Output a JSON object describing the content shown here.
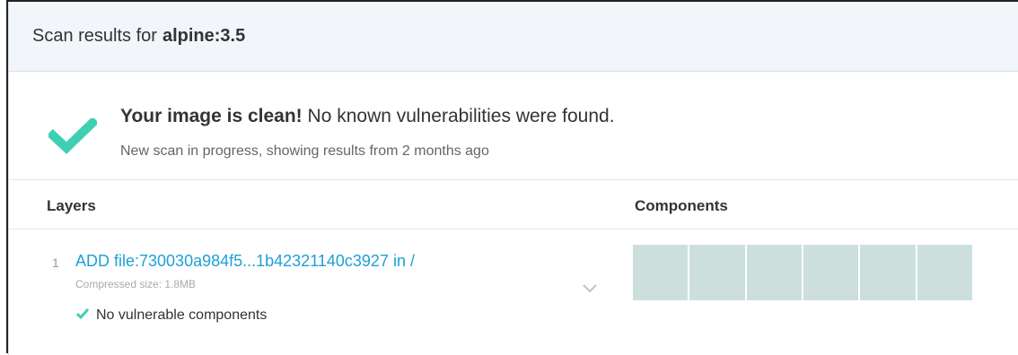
{
  "header": {
    "prefix": "Scan results for",
    "image_name": "alpine:3.5"
  },
  "status": {
    "title_bold": "Your image is clean!",
    "title_rest": "No known vulnerabilities were found.",
    "subtitle": "New scan in progress, showing results from 2 months ago",
    "icon": "checkmark-icon",
    "accent_color": "#3fd0b4"
  },
  "table": {
    "columns": [
      "Layers",
      "Components"
    ],
    "layers": [
      {
        "index": "1",
        "command": "ADD file:730030a984f5...1b42321140c3927 in /",
        "size_label": "Compressed size: 1.8MB",
        "vuln_status": "No vulnerable components",
        "component_segments": 6,
        "component_color": "#cddfdd"
      }
    ]
  },
  "colors": {
    "link": "#1ea0d6",
    "header_bg": "#f2f5f9"
  }
}
